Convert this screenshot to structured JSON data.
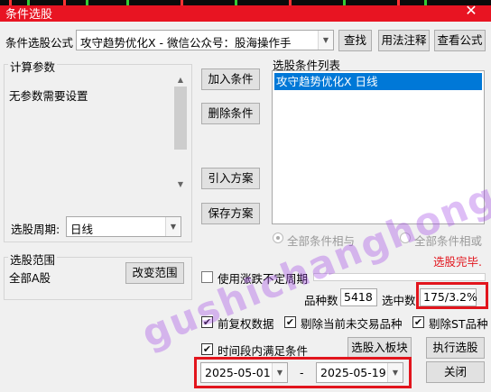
{
  "window": {
    "title": "条件选股",
    "close_glyph": "✕"
  },
  "formula": {
    "label": "条件选股公式",
    "value": "攻守趋势优化X  -  微信公众号：股海操作手",
    "find_button": "查找",
    "usage_button": "用法注释",
    "view_button": "查看公式"
  },
  "params": {
    "group_title": "计算参数",
    "text": "无参数需要设置",
    "period_label": "选股周期:",
    "period_value": "日线"
  },
  "actions": {
    "add": "加入条件",
    "delete": "删除条件",
    "import": "引入方案",
    "save": "保存方案"
  },
  "conditions": {
    "title": "选股条件列表",
    "items": [
      "攻守趋势优化X  日线"
    ],
    "and_label": "全部条件相与",
    "or_label": "全部条件相或"
  },
  "status": {
    "text": "选股完毕.",
    "color": "#e2151d"
  },
  "scope": {
    "group_title": "选股范围",
    "value": "全部A股",
    "change_button": "改变范围"
  },
  "options": {
    "use_dynamic_period": "使用涨跌不定周期",
    "count_label": "品种数",
    "count_value": "5418",
    "selected_label": "选中数",
    "selected_value": "175/3.2%",
    "adjusted_data": "前复权数据",
    "exclude_non_trading": "剔除当前未交易品种",
    "exclude_st": "剔除ST品种",
    "time_range": "时间段内满足条件"
  },
  "buttons": {
    "to_block": "选股入板块",
    "run": "执行选股",
    "close": "关闭"
  },
  "dates": {
    "start": "2025-05-01",
    "separator": "-",
    "end": "2025-05-19"
  },
  "watermark": "gushichanghong.com",
  "colors": {
    "titlebar": "#e81422",
    "selection": "#0078d7",
    "highlight": "#e2151d"
  }
}
